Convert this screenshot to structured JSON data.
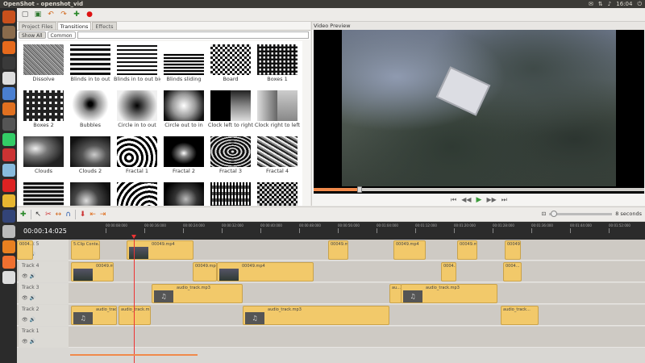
{
  "window": {
    "title": "OpenShot - openshot_vid",
    "clock": "16:04"
  },
  "tabs": [
    "Project Files",
    "Transitions",
    "Effects"
  ],
  "filters": {
    "show_all": "Show All",
    "common": "Common"
  },
  "transitions": [
    {
      "label": "Dissolve",
      "pattern": "p-noise"
    },
    {
      "label": "Blinds in to out",
      "pattern": "p-hstripes"
    },
    {
      "label": "Blinds in to out big",
      "pattern": "p-hstripes2"
    },
    {
      "label": "Blinds sliding",
      "pattern": "p-sliding"
    },
    {
      "label": "Board",
      "pattern": "p-board"
    },
    {
      "label": "Boxes 1",
      "pattern": "p-box"
    },
    {
      "label": "Boxes 2",
      "pattern": "p-box2"
    },
    {
      "label": "Bubbles",
      "pattern": "p-bubbles"
    },
    {
      "label": "Circle in to out",
      "pattern": "p-circlein"
    },
    {
      "label": "Circle out to in",
      "pattern": "p-circleout"
    },
    {
      "label": "Clock left to right",
      "pattern": "p-clockl"
    },
    {
      "label": "Clock right to left",
      "pattern": "p-clockr"
    },
    {
      "label": "Clouds",
      "pattern": "p-clouds"
    },
    {
      "label": "Clouds 2",
      "pattern": "p-clouds2"
    },
    {
      "label": "Fractal 1",
      "pattern": "p-fractal1"
    },
    {
      "label": "Fractal 2",
      "pattern": "p-fractal2"
    },
    {
      "label": "Fractal 3",
      "pattern": "p-fractal3"
    },
    {
      "label": "Fractal 4",
      "pattern": "p-fractal4"
    },
    {
      "label": "",
      "pattern": "p-row4a"
    },
    {
      "label": "",
      "pattern": "p-row4b"
    },
    {
      "label": "",
      "pattern": "p-row4c"
    },
    {
      "label": "",
      "pattern": "p-row4d"
    },
    {
      "label": "",
      "pattern": "p-row4e"
    },
    {
      "label": "",
      "pattern": "p-row4f"
    }
  ],
  "preview": {
    "label": "Video Preview",
    "progress": 0.14
  },
  "timeline": {
    "timecode": "00:00:14:025",
    "zoom_label": "8 seconds",
    "ruler_labels": [
      "00:00:08:000",
      "00:00:16:000",
      "00:00:24:000",
      "00:00:32:000",
      "00:00:40:000",
      "00:00:48:000",
      "00:00:56:000",
      "00:01:04:000",
      "00:01:12:000",
      "00:01:20:000",
      "00:01:28:000",
      "00:01:36:000",
      "00:01:44:000",
      "00:01:52:000",
      "00:02:00:000"
    ],
    "tracks": [
      {
        "name": "Track 5",
        "clips": [
          {
            "text": "5:Clip Conte...",
            "kind": "none"
          },
          {
            "text": "00049.mp4",
            "kind": "video"
          },
          {
            "text": "00049.mp4",
            "kind": "none"
          },
          {
            "text": "00049.mp4",
            "kind": "none"
          },
          {
            "text": "00049.mp4",
            "kind": "none"
          },
          {
            "text": "00049.mp4",
            "kind": "none"
          },
          {
            "text": "0004...",
            "kind": "none"
          }
        ]
      },
      {
        "name": "Track 4",
        "clips": [
          {
            "text": "00049.mp4",
            "kind": "video"
          },
          {
            "text": "00049.mp4",
            "kind": "none"
          },
          {
            "text": "00049.mp4",
            "kind": "video"
          },
          {
            "text": "0004...",
            "kind": "none"
          },
          {
            "text": "0004...",
            "kind": "none"
          }
        ]
      },
      {
        "name": "Track 3",
        "clips": [
          {
            "text": "audio_track.mp3",
            "kind": "audio"
          },
          {
            "text": "au...",
            "kind": "none"
          },
          {
            "text": "audio_track.mp3",
            "kind": "audio"
          }
        ]
      },
      {
        "name": "Track 2",
        "clips": [
          {
            "text": "audio_track...",
            "kind": "audio"
          },
          {
            "text": "audio_track.m...",
            "kind": "none"
          },
          {
            "text": "audio_track.mp3",
            "kind": "audio"
          },
          {
            "text": "audio_track...",
            "kind": "none"
          }
        ]
      },
      {
        "name": "Track 1",
        "clips": []
      }
    ],
    "playhead_time": "00:00:14:025"
  }
}
